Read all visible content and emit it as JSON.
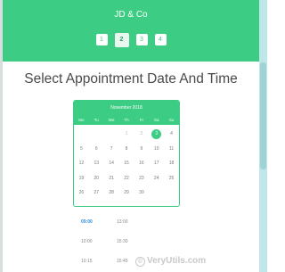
{
  "header": {
    "company": "JD & Co",
    "steps": [
      "1",
      "2",
      "3",
      "4"
    ],
    "active_step": 2,
    "color": "#3dcc83"
  },
  "page": {
    "title": "Select Appointment Date And Time"
  },
  "calendar": {
    "month_label": "November 2018",
    "weekdays": [
      "Mo",
      "Tu",
      "We",
      "Th",
      "Fr",
      "Sa",
      "Su"
    ],
    "weeks": [
      [
        "",
        "",
        "",
        "1",
        "2",
        "3",
        "4"
      ],
      [
        "5",
        "6",
        "7",
        "8",
        "9",
        "10",
        "11"
      ],
      [
        "12",
        "13",
        "14",
        "15",
        "16",
        "17",
        "18"
      ],
      [
        "19",
        "20",
        "21",
        "22",
        "23",
        "24",
        "25"
      ],
      [
        "26",
        "27",
        "28",
        "29",
        "30",
        "",
        ""
      ]
    ],
    "selected_day": "3"
  },
  "times": [
    {
      "label": "09:00",
      "selected": true
    },
    {
      "label": "13:00",
      "selected": false
    },
    {
      "label": "10:00",
      "selected": false
    },
    {
      "label": "15:30",
      "selected": false
    },
    {
      "label": "10:15",
      "selected": false
    },
    {
      "label": "15:45",
      "selected": false
    }
  ],
  "watermark": {
    "text": "VeryUtils.com",
    "icon": "copyright-icon"
  }
}
